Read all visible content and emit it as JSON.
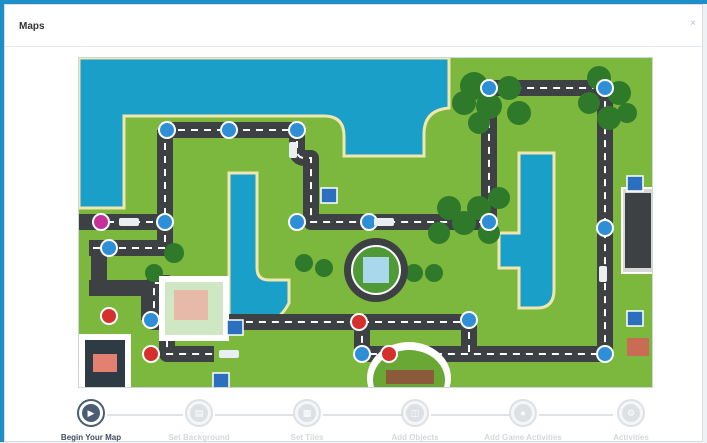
{
  "dialog": {
    "title": "Maps",
    "close_glyph": "×"
  },
  "wizard": {
    "steps": [
      {
        "label": "Begin Your Map",
        "icon": "tag-icon",
        "active": true
      },
      {
        "label": "Set Background",
        "icon": "map-icon",
        "active": false
      },
      {
        "label": "Set Tiles",
        "icon": "grid-icon",
        "active": false
      },
      {
        "label": "Add Objects",
        "icon": "building-icon",
        "active": false
      },
      {
        "label": "Add Game Activities",
        "icon": "location-pin-icon",
        "active": false
      },
      {
        "label": "Activities",
        "icon": "gear-icon",
        "active": false
      }
    ]
  },
  "colors": {
    "water": "#1aa0c8",
    "grass": "#7cb83e",
    "road": "#3d4144",
    "node": "#2e8fd6",
    "accent_active": "#4a5d72"
  }
}
